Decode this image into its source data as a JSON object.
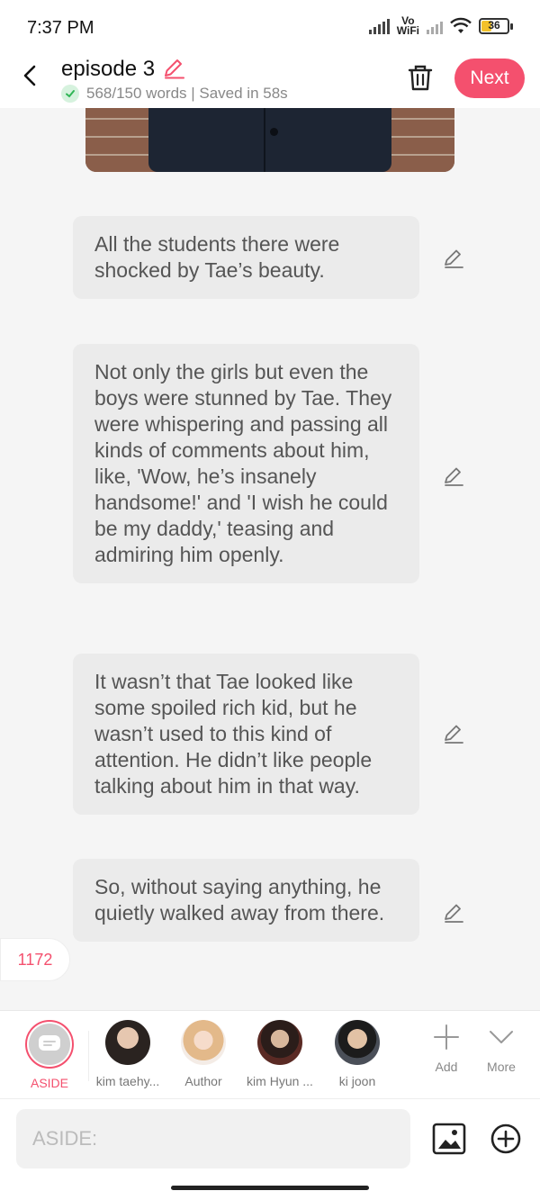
{
  "status_bar": {
    "time": "7:37 PM",
    "volte_top": "Vo",
    "volte_bottom": "WiFi",
    "battery": "36"
  },
  "header": {
    "title": "episode 3",
    "saved_status": "568/150 words | Saved in 58s",
    "next_label": "Next"
  },
  "messages": [
    {
      "text": "All the students there were shocked by Tae’s beauty."
    },
    {
      "text": "Not only the girls but even the boys were stunned by Tae. They were whispering and passing all kinds of comments about him, like, 'Wow, he’s insanely handsome!' and 'I wish he could be my daddy,' teasing and admiring him openly."
    },
    {
      "text": "It wasn’t that Tae looked like some spoiled rich kid, but he wasn’t used to this kind of attention. He didn’t like people talking about him in that way."
    },
    {
      "text": "So, without saying anything, he quietly walked away from there."
    }
  ],
  "count_badge": "1172",
  "characters": [
    {
      "name": "ASIDE"
    },
    {
      "name": "kim taehy..."
    },
    {
      "name": "Author"
    },
    {
      "name": "kim Hyun ..."
    },
    {
      "name": "ki joon"
    }
  ],
  "tools": {
    "add_label": "Add",
    "more_label": "More"
  },
  "input": {
    "placeholder": "ASIDE:"
  },
  "colors": {
    "accent": "#f4506e",
    "bubble": "#ebebeb",
    "background": "#f5f5f5"
  }
}
